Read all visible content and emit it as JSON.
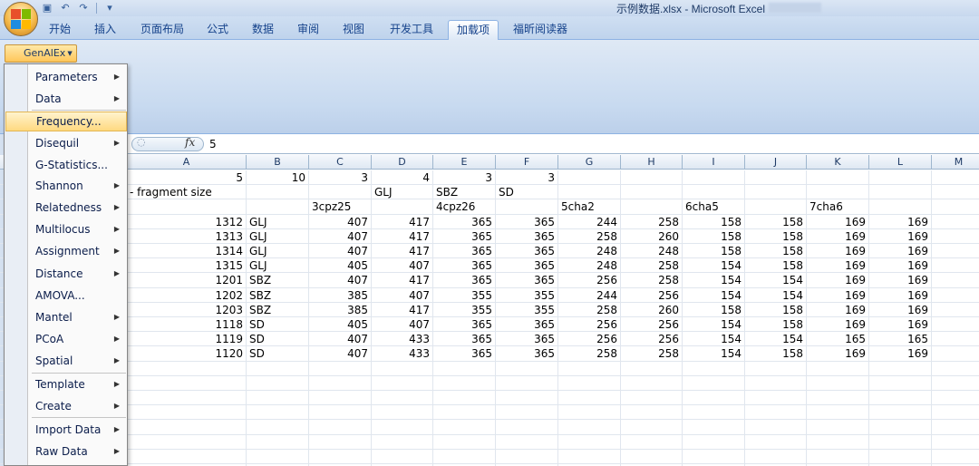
{
  "window": {
    "title": "示例数据.xlsx - Microsoft Excel"
  },
  "tabs": [
    "开始",
    "插入",
    "页面布局",
    "公式",
    "数据",
    "审阅",
    "视图",
    "开发工具",
    "加载项",
    "福昕阅读器"
  ],
  "active_tab": "加载项",
  "ribbon": {
    "genalex_label": "GenAlEx"
  },
  "formula_bar": {
    "fx": "fx",
    "value": "5"
  },
  "menu": {
    "items": [
      {
        "label": "Parameters",
        "submenu": true
      },
      {
        "label": "Data",
        "submenu": true
      },
      {
        "label": "Frequency...",
        "submenu": false,
        "highlighted": true
      },
      {
        "label": "Disequil",
        "submenu": true
      },
      {
        "label": "G-Statistics...",
        "submenu": false
      },
      {
        "label": "Shannon",
        "submenu": true
      },
      {
        "label": "Relatedness",
        "submenu": true
      },
      {
        "label": "Multilocus",
        "submenu": true
      },
      {
        "label": "Assignment",
        "submenu": true
      },
      {
        "label": "Distance",
        "submenu": true
      },
      {
        "label": "AMOVA...",
        "submenu": false
      },
      {
        "label": "Mantel",
        "submenu": true
      },
      {
        "label": "PCoA",
        "submenu": true
      },
      {
        "label": "Spatial",
        "submenu": true
      },
      {
        "label": "Template",
        "submenu": true
      },
      {
        "label": "Create",
        "submenu": true
      },
      {
        "label": "Import Data",
        "submenu": true
      },
      {
        "label": "Raw Data",
        "submenu": true
      }
    ]
  },
  "sheet": {
    "columns": [
      "A",
      "B",
      "C",
      "D",
      "E",
      "F",
      "G",
      "H",
      "I",
      "J",
      "K",
      "L",
      "M"
    ],
    "rows": [
      [
        "5",
        "10",
        "3",
        "4",
        "3",
        "3",
        "",
        "",
        "",
        "",
        "",
        "",
        ""
      ],
      [
        "- fragment size",
        "",
        "",
        "GLJ",
        "SBZ",
        "SD",
        "",
        "",
        "",
        "",
        "",
        "",
        ""
      ],
      [
        "",
        "",
        "3cpz25",
        "",
        "4cpz26",
        "",
        "5cha2",
        "",
        "6cha5",
        "",
        "7cha6",
        "",
        ""
      ],
      [
        "1312",
        "GLJ",
        "407",
        "417",
        "365",
        "365",
        "244",
        "258",
        "158",
        "158",
        "169",
        "169",
        ""
      ],
      [
        "1313",
        "GLJ",
        "407",
        "417",
        "365",
        "365",
        "258",
        "260",
        "158",
        "158",
        "169",
        "169",
        ""
      ],
      [
        "1314",
        "GLJ",
        "407",
        "417",
        "365",
        "365",
        "248",
        "248",
        "158",
        "158",
        "169",
        "169",
        ""
      ],
      [
        "1315",
        "GLJ",
        "405",
        "407",
        "365",
        "365",
        "248",
        "258",
        "154",
        "158",
        "169",
        "169",
        ""
      ],
      [
        "1201",
        "SBZ",
        "407",
        "417",
        "365",
        "365",
        "256",
        "258",
        "154",
        "154",
        "169",
        "169",
        ""
      ],
      [
        "1202",
        "SBZ",
        "385",
        "407",
        "355",
        "355",
        "244",
        "256",
        "154",
        "154",
        "169",
        "169",
        ""
      ],
      [
        "1203",
        "SBZ",
        "385",
        "417",
        "355",
        "355",
        "258",
        "260",
        "158",
        "158",
        "169",
        "169",
        ""
      ],
      [
        "1118",
        "SD",
        "405",
        "407",
        "365",
        "365",
        "256",
        "256",
        "154",
        "158",
        "169",
        "169",
        ""
      ],
      [
        "1119",
        "SD",
        "407",
        "433",
        "365",
        "365",
        "256",
        "256",
        "154",
        "154",
        "165",
        "165",
        ""
      ],
      [
        "1120",
        "SD",
        "407",
        "433",
        "365",
        "365",
        "258",
        "258",
        "154",
        "158",
        "169",
        "169",
        ""
      ]
    ]
  }
}
